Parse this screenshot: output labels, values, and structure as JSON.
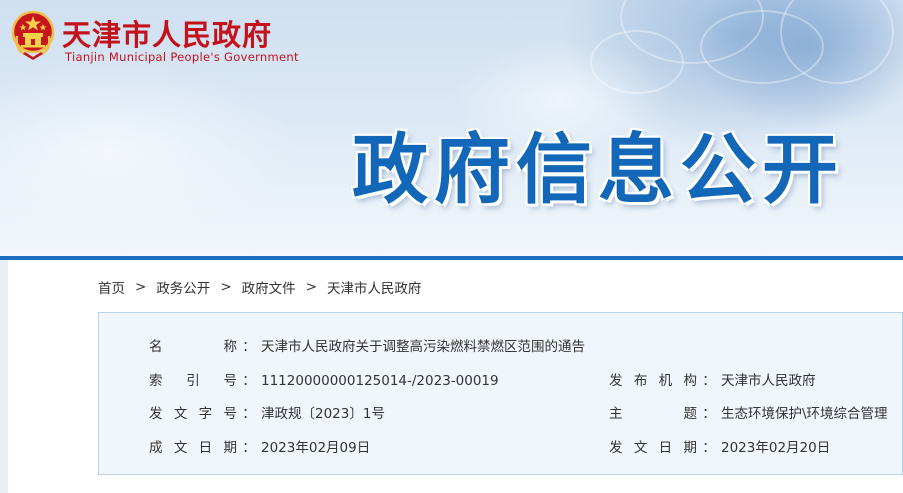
{
  "header": {
    "site_title_cn": "天津市人民政府",
    "site_title_en": "Tianjin Municipal People's Government",
    "hero_title": "政府信息公开",
    "accent_red": "#c4121b",
    "accent_blue": "#1367b8"
  },
  "breadcrumb": {
    "items": [
      "首页",
      "政务公开",
      "政府文件",
      "天津市人民政府"
    ],
    "separator": ">"
  },
  "info": {
    "colon": "：",
    "name_label": "名称",
    "name_value": "天津市人民政府关于调整高污染燃料禁燃区范围的通告",
    "index_label": "索引号",
    "index_value": "11120000000125014-/2023-00019",
    "publisher_label": "发布机构",
    "publisher_value": "天津市人民政府",
    "doc_no_label": "发文字号",
    "doc_no_value": "津政规〔2023〕1号",
    "topic_label": "主题",
    "topic_value": "生态环境保护\\环境综合管理",
    "written_date_label": "成文日期",
    "written_date_value": "2023年02月09日",
    "publish_date_label": "发文日期",
    "publish_date_value": "2023年02月20日"
  }
}
